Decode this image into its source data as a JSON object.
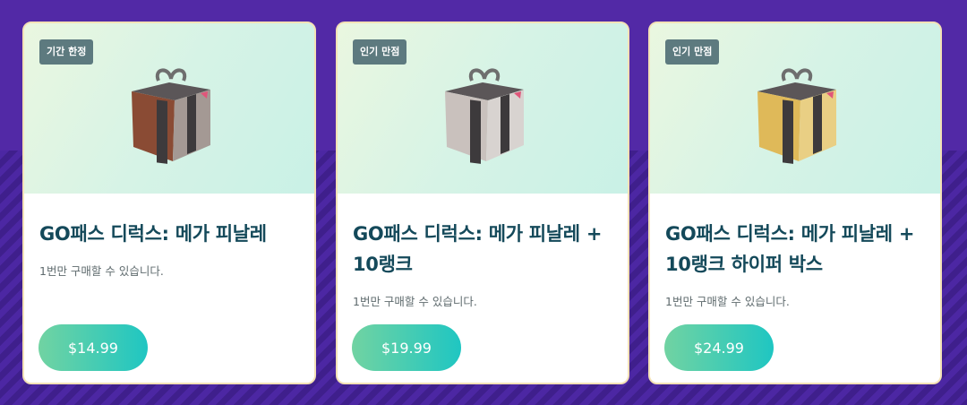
{
  "cards": [
    {
      "badge": "기간 한정",
      "title": "GO패스 디럭스: 메가 피날레",
      "limit": "1번만 구매할 수 있습니다.",
      "price": "$14.99",
      "box_color": "#8a4b34",
      "box_icon": "gift-box-bronze-icon"
    },
    {
      "badge": "인기 만점",
      "title": "GO패스 디럭스: 메가 피날레 + 10랭크",
      "limit": "1번만 구매할 수 있습니다.",
      "price": "$19.99",
      "box_color": "#c9c1bd",
      "box_icon": "gift-box-silver-icon"
    },
    {
      "badge": "인기 만점",
      "title": "GO패스 디럭스: 메가 피날레 + 10랭크 하이퍼 박스",
      "limit": "1번만 구매할 수 있습니다.",
      "price": "$24.99",
      "box_color": "#dfb959",
      "box_icon": "gift-box-gold-icon"
    }
  ]
}
